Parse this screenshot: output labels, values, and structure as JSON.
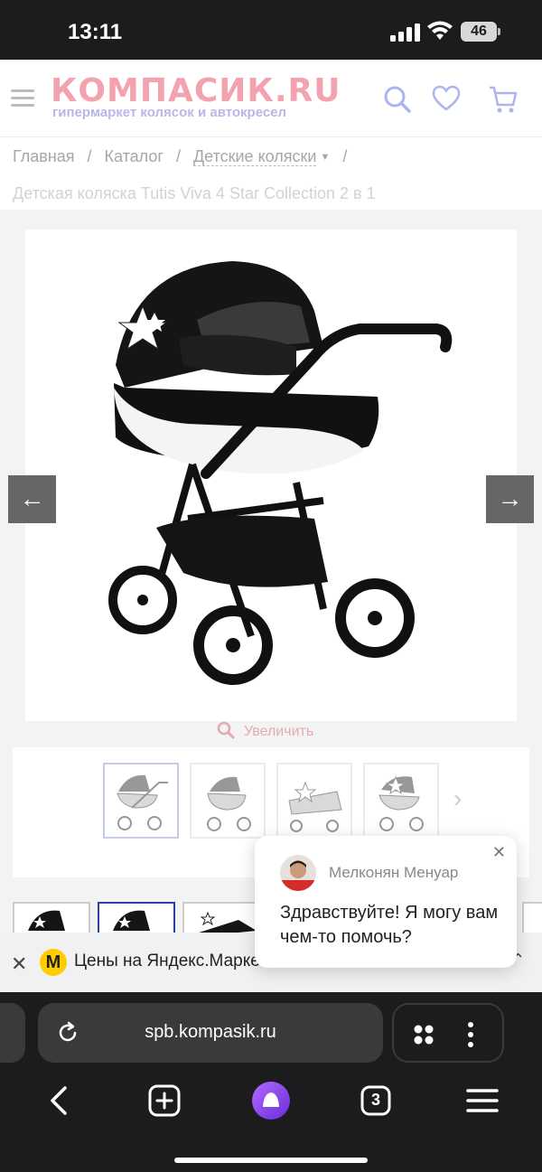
{
  "status_bar": {
    "time": "13:11",
    "battery": "46"
  },
  "header": {
    "logo": "КОМПАСИК.RU",
    "tagline": "гипермаркет колясок и автокресел",
    "colors": {
      "logo_pink": "#f3a3b0",
      "logo_lilac": "#b9b6e8",
      "icon_blue": "#aab4f0"
    }
  },
  "breadcrumb": {
    "items": [
      "Главная",
      "Каталог",
      "Детские коляски"
    ],
    "separator": "/",
    "current": "Детская коляска Tutis Viva 4 Star Collection 2 в 1"
  },
  "gallery": {
    "prev_icon": "arrow-left-icon",
    "next_icon": "arrow-right-icon",
    "zoom_label": "Увеличить",
    "thumbnail_count": 4,
    "active_thumbnail": 1,
    "color_thumbnails_active": 2
  },
  "market_bar": {
    "logo_letter": "М",
    "text": "Цены на Яндекс.Марке"
  },
  "chat": {
    "agent_name": "Мелконян Менуар",
    "message": "Здравствуйте! Я могу вам чем-то помочь?"
  },
  "browser": {
    "url": "spb.kompasik.ru",
    "tabs_count": "3"
  }
}
